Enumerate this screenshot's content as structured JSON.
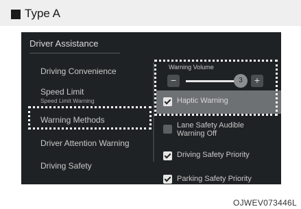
{
  "header": {
    "type_label": "Type A"
  },
  "screen": {
    "title": "Driver Assistance",
    "menu": [
      {
        "label": "Driving Convenience"
      },
      {
        "label": "Speed Limit",
        "sub": "Speed Limit Warning"
      },
      {
        "label": "Warning Methods"
      },
      {
        "label": "Driver Attention Warning"
      },
      {
        "label": "Driving Safety"
      }
    ],
    "warning_volume": {
      "label": "Warning Volume",
      "value": "3",
      "minus": "−",
      "plus": "+"
    },
    "options": [
      {
        "label": "Haptic Warning",
        "checked": true
      },
      {
        "label": "Lane Safety Audible Warning Off",
        "checked": false
      },
      {
        "label": "Driving Safety Priority",
        "checked": true
      },
      {
        "label": "Parking Safety Priority",
        "checked": true
      }
    ]
  },
  "footer": {
    "code": "OJWEV073446L"
  }
}
